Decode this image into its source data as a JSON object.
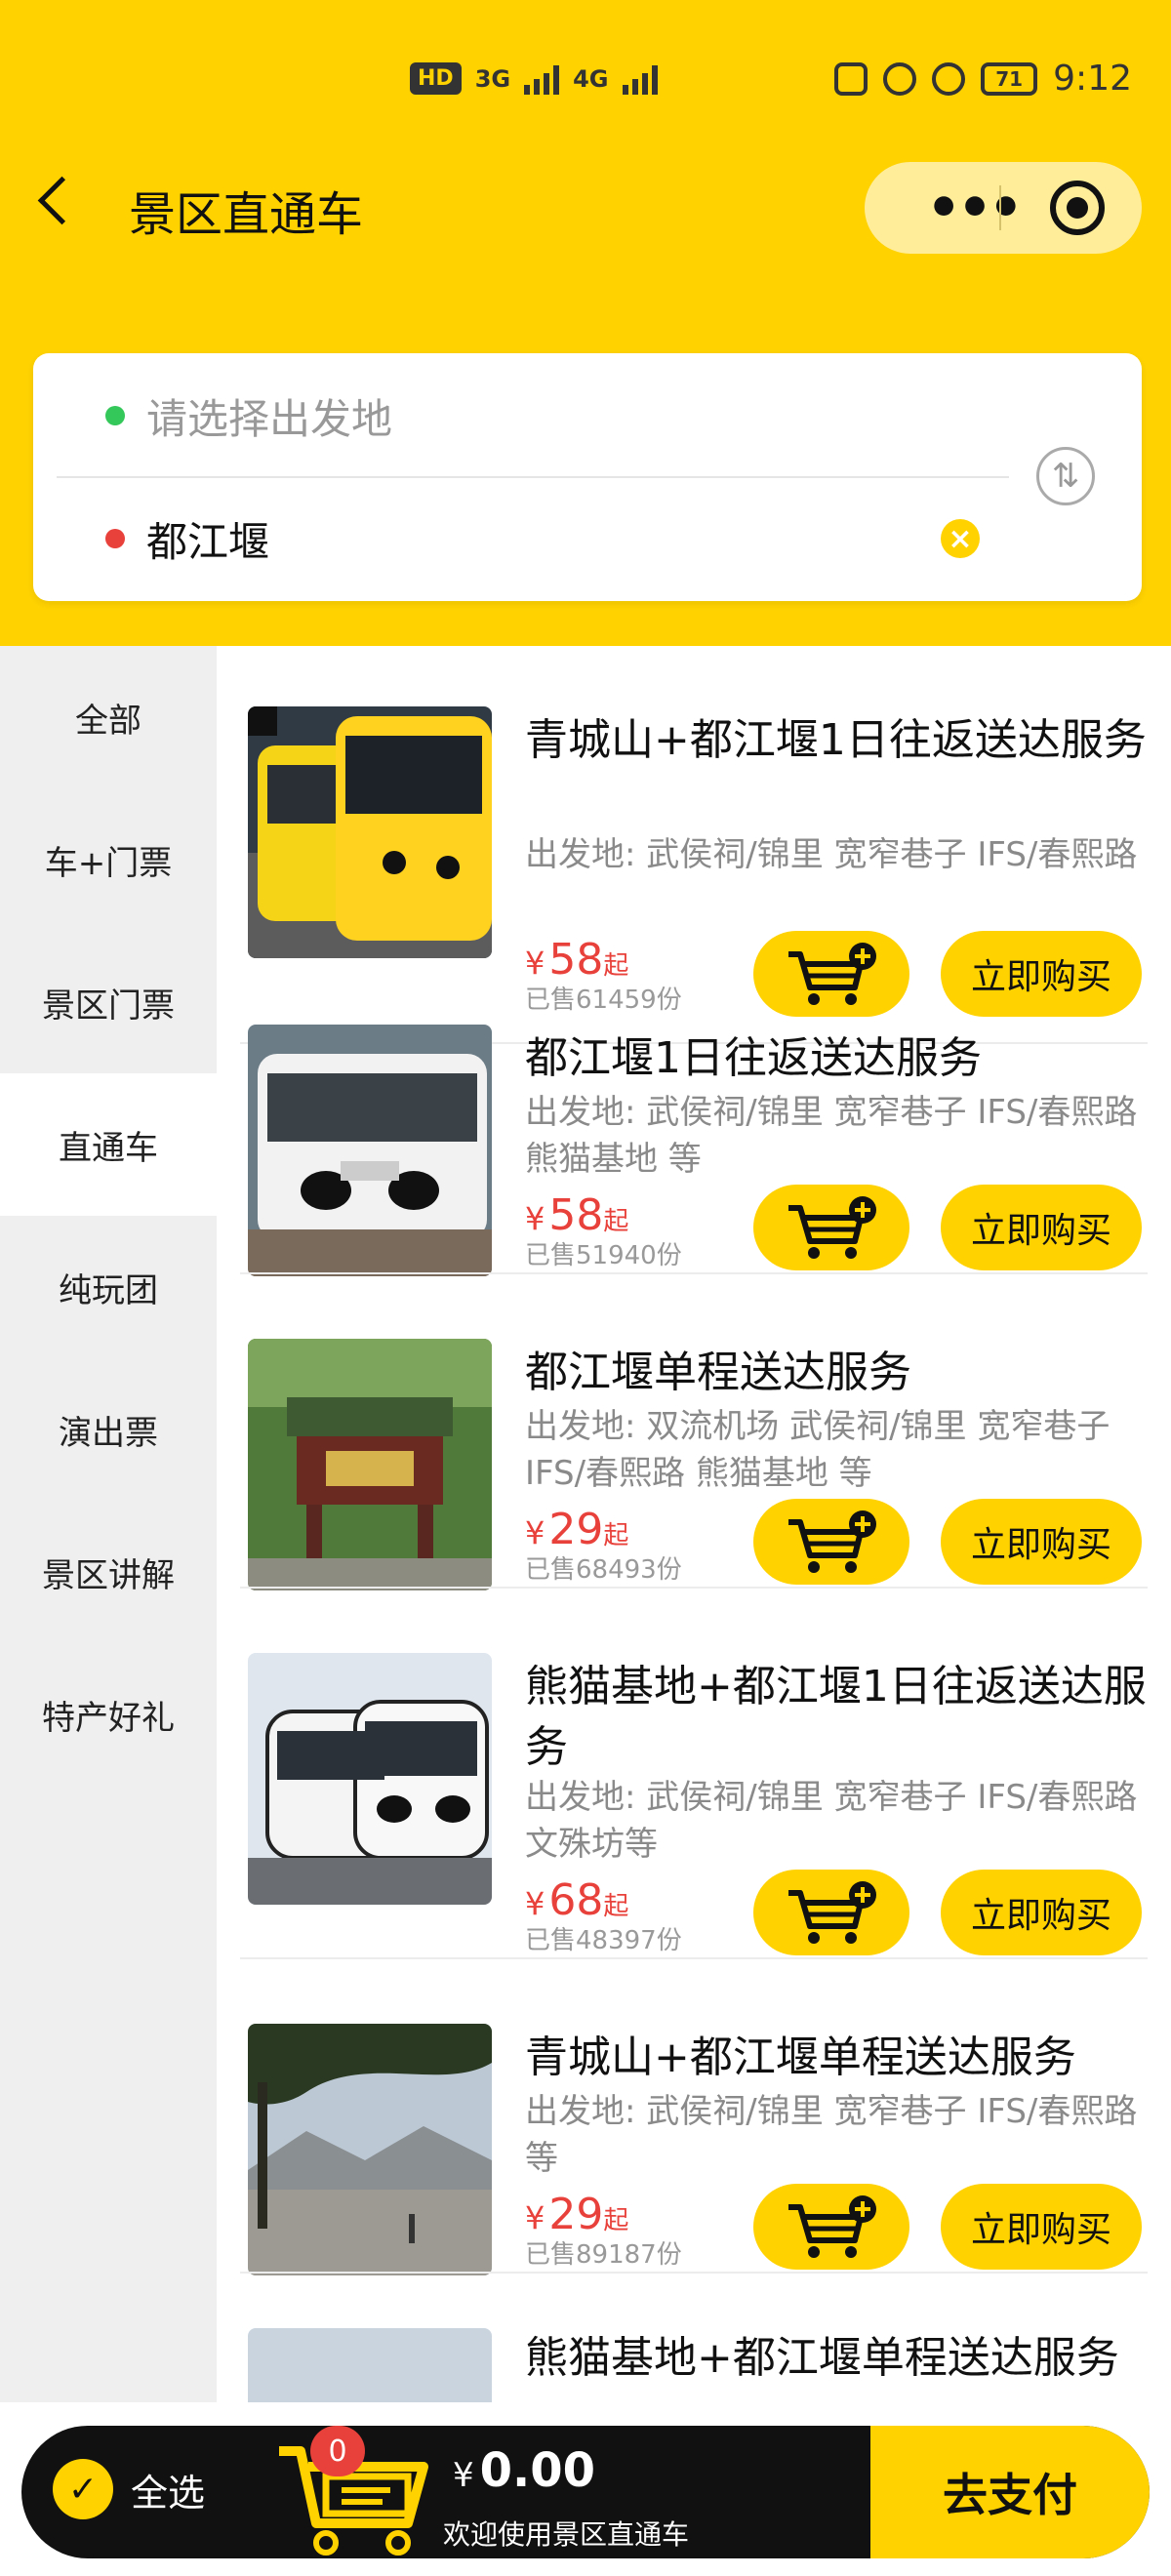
{
  "status_bar": {
    "network_hd": "HD",
    "net_3g": "3G",
    "net_4g": "4G",
    "battery": "71",
    "time": "9:12"
  },
  "header": {
    "title": "景区直通车"
  },
  "route": {
    "from_placeholder": "请选择出发地",
    "to_value": "都江堰"
  },
  "sidebar": {
    "items": [
      {
        "label": "全部"
      },
      {
        "label": "车+门票"
      },
      {
        "label": "景区门票"
      },
      {
        "label": "直通车"
      },
      {
        "label": "纯玩团"
      },
      {
        "label": "演出票"
      },
      {
        "label": "景区讲解"
      },
      {
        "label": "特产好礼"
      }
    ]
  },
  "products": [
    {
      "title": "青城山+都江堰1日往返送达服务",
      "origin": "出发地:   武侯祠/锦里 宽窄巷子 IFS/春熙路",
      "currency": "¥",
      "price": "58",
      "price_suffix": "起",
      "sold": "已售61459份",
      "buy_label": "立即购买"
    },
    {
      "title": "都江堰1日往返送达服务",
      "origin": "出发地:   武侯祠/锦里 宽窄巷子 IFS/春熙路 熊猫基地 等",
      "currency": "¥",
      "price": "58",
      "price_suffix": "起",
      "sold": "已售51940份",
      "buy_label": "立即购买"
    },
    {
      "title": "都江堰单程送达服务",
      "origin": "出发地:   双流机场 武侯祠/锦里 宽窄巷子 IFS/春熙路 熊猫基地 等",
      "currency": "¥",
      "price": "29",
      "price_suffix": "起",
      "sold": "已售68493份",
      "buy_label": "立即购买"
    },
    {
      "title": "熊猫基地+都江堰1日往返送达服务",
      "origin": "出发地:   武侯祠/锦里 宽窄巷子 IFS/春熙路 文殊坊等",
      "currency": "¥",
      "price": "68",
      "price_suffix": "起",
      "sold": "已售48397份",
      "buy_label": "立即购买"
    },
    {
      "title": "青城山+都江堰单程送达服务",
      "origin": "出发地:   武侯祠/锦里 宽窄巷子 IFS/春熙路 等",
      "currency": "¥",
      "price": "29",
      "price_suffix": "起",
      "sold": "已售89187份",
      "buy_label": "立即购买"
    },
    {
      "title": "熊猫基地+都江堰单程送达服务"
    }
  ],
  "bottom_bar": {
    "select_all": "全选",
    "cart_count": "0",
    "currency": "¥",
    "total": "0.00",
    "welcome": "欢迎使用景区直通车",
    "pay_label": "去支付"
  },
  "colors": {
    "brand_yellow": "#FFD200",
    "price_red": "#E8403A",
    "bottom_bar": "#111111"
  }
}
